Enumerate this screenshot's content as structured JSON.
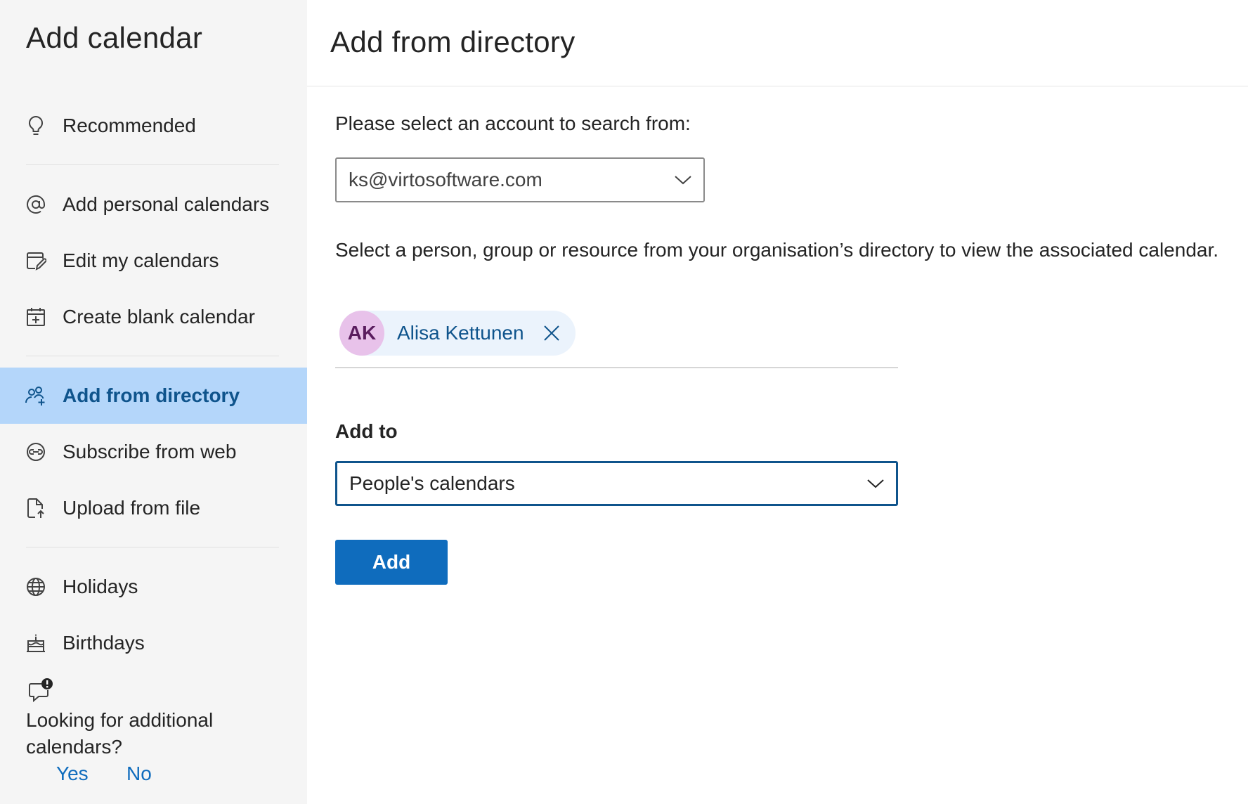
{
  "sidebar": {
    "title": "Add calendar",
    "items": [
      {
        "label": "Recommended",
        "icon": "lightbulb-icon"
      },
      {
        "label": "Add personal calendars",
        "icon": "at-sign-icon"
      },
      {
        "label": "Edit my calendars",
        "icon": "edit-calendar-icon"
      },
      {
        "label": "Create blank calendar",
        "icon": "calendar-add-icon"
      },
      {
        "label": "Add from directory",
        "icon": "people-add-icon",
        "active": true
      },
      {
        "label": "Subscribe from web",
        "icon": "link-circle-icon"
      },
      {
        "label": "Upload from file",
        "icon": "file-upload-icon"
      },
      {
        "label": "Holidays",
        "icon": "globe-icon"
      },
      {
        "label": "Birthdays",
        "icon": "cake-icon"
      }
    ],
    "feedback": {
      "icon": "chat-alert-icon",
      "question": "Looking for additional calendars?",
      "yes": "Yes",
      "no": "No"
    }
  },
  "main": {
    "title": "Add from directory",
    "account_prompt": "Please select an account to search from:",
    "account_select": {
      "value": "ks@virtosoftware.com"
    },
    "directory_description": "Select a person, group or resource from your organisation’s directory to view the associated calendar.",
    "selected_person": {
      "initials": "AK",
      "name": "Alisa Kettunen"
    },
    "add_to_label": "Add to",
    "add_to_select": {
      "value": "People's calendars"
    },
    "add_button": "Add"
  },
  "colors": {
    "sidebar_bg": "#f5f5f5",
    "active_bg": "#b4d6fa",
    "active_text": "#0f548c",
    "primary": "#0f6cbd",
    "avatar_bg": "#e8c2ea",
    "chip_bg": "#ebf3fc"
  }
}
